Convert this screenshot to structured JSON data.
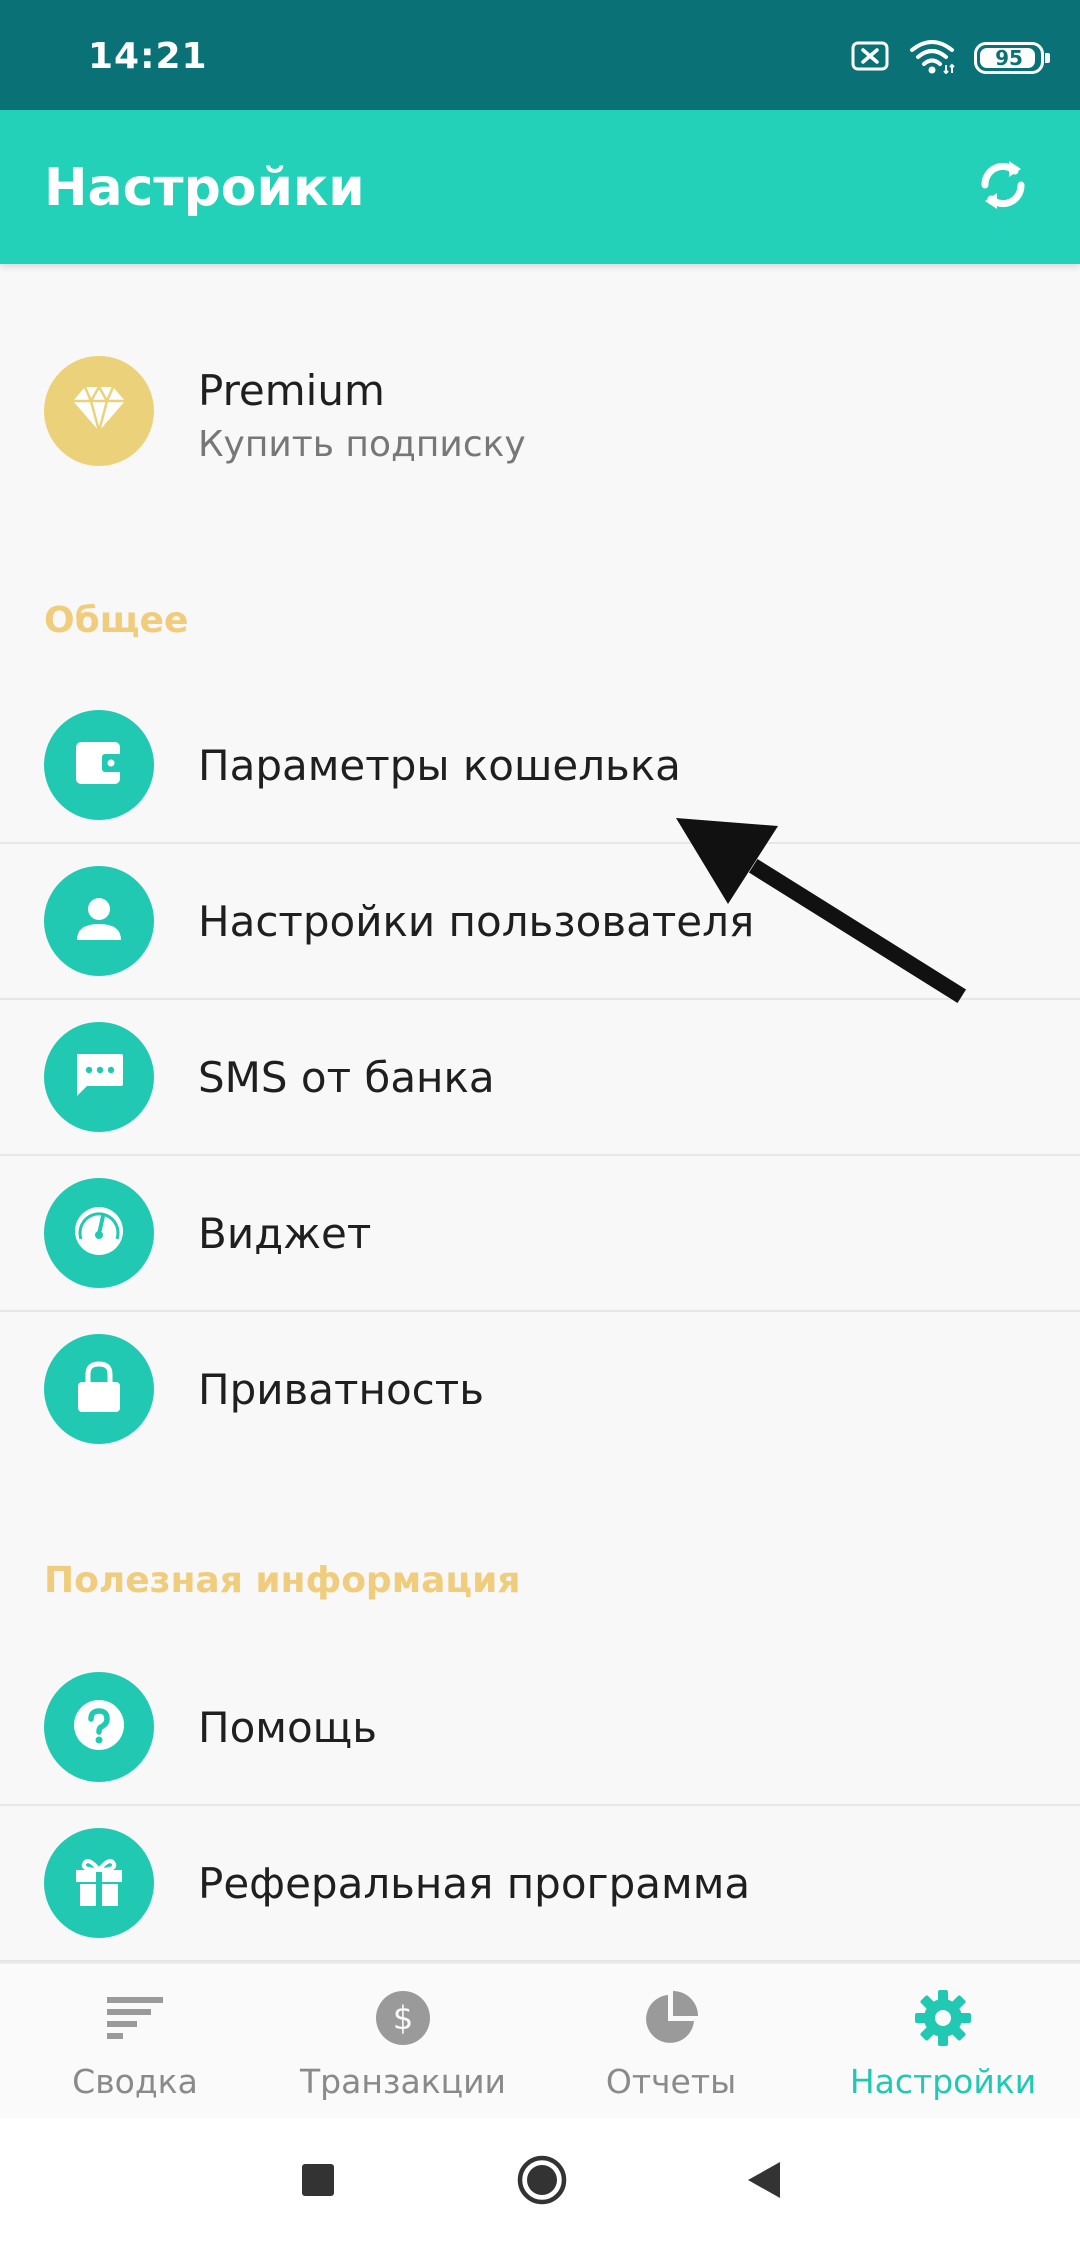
{
  "status_bar": {
    "time": "14:21",
    "battery_level": "95",
    "battery_fraction": 0.95,
    "icons": [
      "sim-disabled-icon",
      "wifi-icon",
      "battery-icon"
    ]
  },
  "app_bar": {
    "title": "Настройки",
    "action_icon": "sync-icon"
  },
  "premium": {
    "title": "Premium",
    "subtitle": "Купить подписку",
    "icon": "diamond-icon",
    "color": "#ebd27a"
  },
  "sections": {
    "general": {
      "header": "Общее",
      "items": [
        {
          "label": "Параметры кошелька",
          "icon": "wallet-icon"
        },
        {
          "label": "Настройки пользователя",
          "icon": "user-icon"
        },
        {
          "label": "SMS от банка",
          "icon": "sms-icon"
        },
        {
          "label": "Виджет",
          "icon": "gauge-icon"
        },
        {
          "label": "Приватность",
          "icon": "lock-icon"
        }
      ]
    },
    "info": {
      "header": "Полезная информация",
      "items": [
        {
          "label": "Помощь",
          "icon": "help-icon"
        },
        {
          "label": "Реферальная программа",
          "icon": "gift-icon"
        }
      ]
    }
  },
  "bottom_nav": {
    "items": [
      {
        "label": "Сводка",
        "icon": "summary-icon",
        "active": false
      },
      {
        "label": "Транзакции",
        "icon": "dollar-icon",
        "active": false
      },
      {
        "label": "Отчеты",
        "icon": "pie-chart-icon",
        "active": false
      },
      {
        "label": "Настройки",
        "icon": "gear-icon",
        "active": true
      }
    ]
  },
  "colors": {
    "status_bar": "#0a7276",
    "accent": "#22d1b8",
    "icon_circle": "#22c9b2",
    "section_header": "#efcd7c",
    "nav_inactive": "#8a8a8a"
  },
  "system_nav": {
    "buttons": [
      "recents-icon",
      "home-icon",
      "back-icon"
    ]
  }
}
